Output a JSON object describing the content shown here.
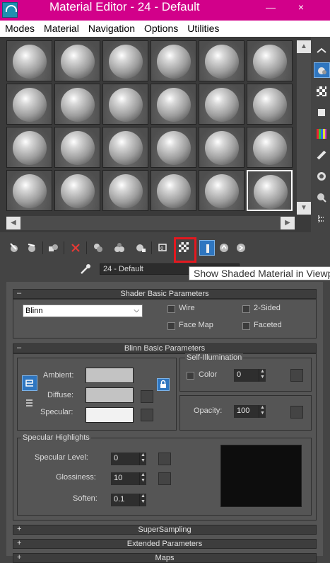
{
  "window": {
    "title": "Material Editor - 24 - Default",
    "app_icon_text": "MAX",
    "controls": [
      "—",
      "×"
    ]
  },
  "menu": [
    "Modes",
    "Material",
    "Navigation",
    "Options",
    "Utilities"
  ],
  "slots": {
    "count": 24,
    "active_index": 23
  },
  "material_name": "24 - Default",
  "tooltip": "Show Shaded Material in Viewport",
  "shader_basic": {
    "header": "Shader Basic Parameters",
    "toggle": "–",
    "shader": "Blinn",
    "wire": "Wire",
    "two_sided": "2-Sided",
    "face_map": "Face Map",
    "faceted": "Faceted"
  },
  "blinn_basic": {
    "header": "Blinn Basic Parameters",
    "toggle": "–",
    "ambient": "Ambient:",
    "diffuse": "Diffuse:",
    "specular": "Specular:",
    "self_illum_title": "Self-Illumination",
    "color_label": "Color",
    "self_illum_value": "0",
    "opacity_label": "Opacity:",
    "opacity_value": "100"
  },
  "specular_highlights": {
    "title": "Specular Highlights",
    "level_label": "Specular Level:",
    "level_value": "0",
    "gloss_label": "Glossiness:",
    "gloss_value": "10",
    "soften_label": "Soften:",
    "soften_value": "0.1"
  },
  "rollouts_collapsed": [
    {
      "toggle": "+",
      "label": "SuperSampling"
    },
    {
      "toggle": "+",
      "label": "Extended Parameters"
    },
    {
      "toggle": "+",
      "label": "Maps"
    }
  ],
  "colors": {
    "title_bar": "#d2008a",
    "ambient": "#c3c3c3",
    "diffuse": "#c3c3c3",
    "specular": "#f2f2f2",
    "highlight_preview": "#0d0d0d",
    "tooltip_highlight": "#e3181f"
  },
  "icons": {
    "toolbar": [
      "get-material-icon",
      "put-to-scene-icon",
      "assign-material-icon",
      "reset-icon",
      "make-copy-icon",
      "make-unique-icon",
      "put-to-library-icon",
      "material-id-icon",
      "show-shaded-material-icon",
      "show-end-result-icon",
      "go-to-parent-icon",
      "go-forward-sibling-icon"
    ],
    "side": [
      "sample-type-icon",
      "backlight-icon",
      "background-icon",
      "uv-tiling-icon",
      "video-color-check-icon",
      "make-preview-icon",
      "options-icon",
      "select-by-material-icon",
      "material-map-navigator-icon"
    ]
  }
}
